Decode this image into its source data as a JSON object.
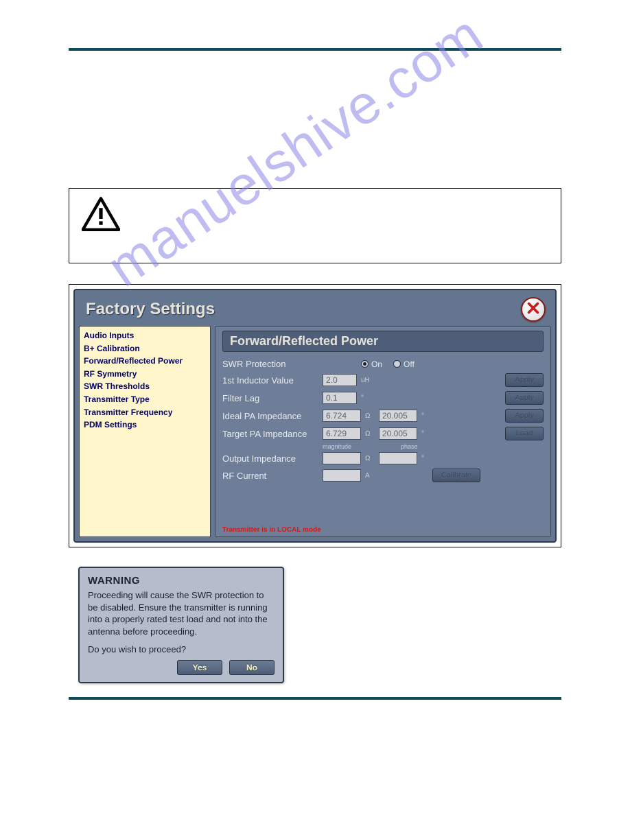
{
  "watermark": "manuelshive.com",
  "factory": {
    "title": "Factory Settings",
    "sidebar": [
      "Audio Inputs",
      "B+ Calibration",
      "Forward/Reflected Power",
      "RF Symmetry",
      "SWR Thresholds",
      "Transmitter Type",
      "Transmitter Frequency",
      "PDM Settings"
    ],
    "main_title": "Forward/Reflected Power",
    "swr_protection_label": "SWR Protection",
    "swr_on": "On",
    "swr_off": "Off",
    "inductor_label": "1st Inductor Value",
    "inductor_value": "2.0",
    "inductor_unit": "uH",
    "filter_lag_label": "Filter Lag",
    "filter_lag_value": "0.1",
    "filter_lag_unit": "°",
    "ideal_label": "Ideal PA Impedance",
    "ideal_mag": "6.724",
    "ideal_mag_unit": "Ω",
    "ideal_phase": "20.005",
    "ideal_phase_unit": "°",
    "target_label": "Target PA Impedance",
    "target_mag": "6.729",
    "target_mag_unit": "Ω",
    "target_phase": "20.005",
    "target_phase_unit": "°",
    "col_mag": "magnitude",
    "col_phase": "phase",
    "output_label": "Output Impedance",
    "output_unit_mag": "Ω",
    "output_unit_phase": "°",
    "rfcurrent_label": "RF Current",
    "rfcurrent_unit": "A",
    "apply": "Apply",
    "load": "Load",
    "calibrate": "Calibrate",
    "status_footer": "Transmitter is in LOCAL mode"
  },
  "warning": {
    "title": "WARNING",
    "body": "Proceeding will cause the SWR protection to be disabled. Ensure the transmitter is running into a properly rated test load and not into the antenna before proceeding.",
    "question": "Do you wish to proceed?",
    "yes": "Yes",
    "no": "No"
  }
}
